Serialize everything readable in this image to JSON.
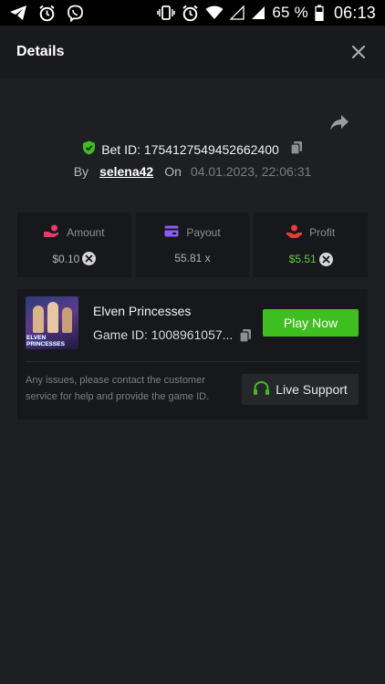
{
  "status_bar": {
    "left_icons": [
      "telegram-icon",
      "alarm-icon",
      "viber-icon"
    ],
    "right_icons": [
      "vibrate-icon",
      "alarm-icon",
      "wifi-icon",
      "signal-empty-icon",
      "signal-icon",
      "battery-icon"
    ],
    "battery": "65 %",
    "time": "06:13"
  },
  "header": {
    "title": "Details",
    "close_icon": "close-icon"
  },
  "bet": {
    "label": "Bet ID: 1754127549452662400",
    "by_label": "By",
    "user": "selena42",
    "on_label": "On",
    "date": "04.01.2023, 22:06:31"
  },
  "stats": [
    {
      "label": "Amount",
      "value": "$0.10",
      "icon": "hand-coin-icon",
      "has_currency_icon": true
    },
    {
      "label": "Payout",
      "value": "55.81 x",
      "icon": "card-icon",
      "has_currency_icon": false
    },
    {
      "label": "Profit",
      "value": "$5.51",
      "icon": "profit-icon",
      "has_currency_icon": true
    }
  ],
  "game": {
    "name": "Elven Princesses",
    "id_text": "Game ID: 1008961057...",
    "thumbnail_text": "ELVEN PRINCESSES",
    "play_label": "Play Now",
    "help_text": "Any issues, please contact the customer service for help and provide the game ID.",
    "support_label": "Live Support"
  },
  "colors": {
    "accent_green": "#3fbe1f",
    "profit_green": "#5ad135",
    "amount_icon": "#e83b6b",
    "payout_icon": "#8b5cf6",
    "profit_icon": "#e83b3b",
    "shield_green": "#3fbe1f"
  }
}
